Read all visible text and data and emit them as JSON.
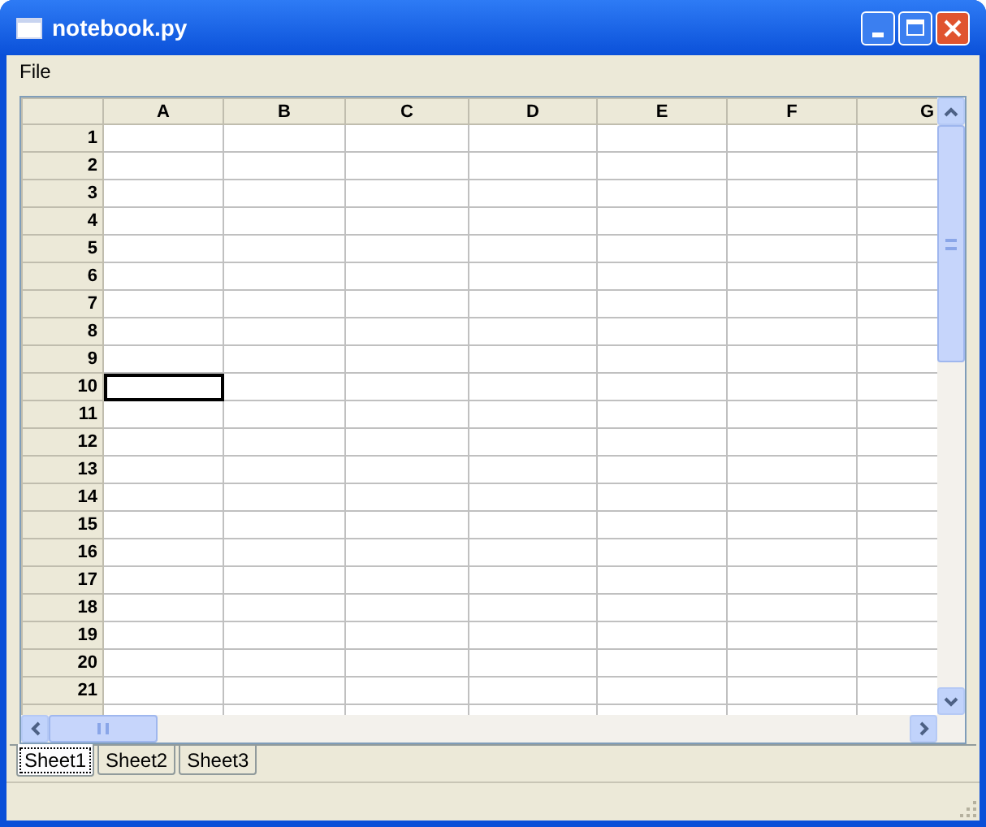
{
  "window": {
    "title": "notebook.py"
  },
  "menu": [
    "File"
  ],
  "grid": {
    "columns": [
      "A",
      "B",
      "C",
      "D",
      "E",
      "F",
      "G"
    ],
    "rows": [
      {
        "label": "1",
        "cells": [
          {
            "selected": false
          },
          {
            "selected": false
          },
          {
            "selected": false
          },
          {
            "selected": false
          },
          {
            "selected": false
          },
          {
            "selected": false
          },
          {
            "selected": false
          }
        ]
      },
      {
        "label": "2",
        "cells": [
          {
            "selected": false
          },
          {
            "selected": false
          },
          {
            "selected": false
          },
          {
            "selected": false
          },
          {
            "selected": false
          },
          {
            "selected": false
          },
          {
            "selected": false
          }
        ]
      },
      {
        "label": "3",
        "cells": [
          {
            "selected": false
          },
          {
            "selected": false
          },
          {
            "selected": false
          },
          {
            "selected": false
          },
          {
            "selected": false
          },
          {
            "selected": false
          },
          {
            "selected": false
          }
        ]
      },
      {
        "label": "4",
        "cells": [
          {
            "selected": false
          },
          {
            "selected": false
          },
          {
            "selected": false
          },
          {
            "selected": false
          },
          {
            "selected": false
          },
          {
            "selected": false
          },
          {
            "selected": false
          }
        ]
      },
      {
        "label": "5",
        "cells": [
          {
            "selected": false
          },
          {
            "selected": false
          },
          {
            "selected": false
          },
          {
            "selected": false
          },
          {
            "selected": false
          },
          {
            "selected": false
          },
          {
            "selected": false
          }
        ]
      },
      {
        "label": "6",
        "cells": [
          {
            "selected": false
          },
          {
            "selected": false
          },
          {
            "selected": false
          },
          {
            "selected": false
          },
          {
            "selected": false
          },
          {
            "selected": false
          },
          {
            "selected": false
          }
        ]
      },
      {
        "label": "7",
        "cells": [
          {
            "selected": false
          },
          {
            "selected": false
          },
          {
            "selected": false
          },
          {
            "selected": false
          },
          {
            "selected": false
          },
          {
            "selected": false
          },
          {
            "selected": false
          }
        ]
      },
      {
        "label": "8",
        "cells": [
          {
            "selected": false
          },
          {
            "selected": false
          },
          {
            "selected": false
          },
          {
            "selected": false
          },
          {
            "selected": false
          },
          {
            "selected": false
          },
          {
            "selected": false
          }
        ]
      },
      {
        "label": "9",
        "cells": [
          {
            "selected": false
          },
          {
            "selected": false
          },
          {
            "selected": false
          },
          {
            "selected": false
          },
          {
            "selected": false
          },
          {
            "selected": false
          },
          {
            "selected": false
          }
        ]
      },
      {
        "label": "10",
        "cells": [
          {
            "selected": true
          },
          {
            "selected": false
          },
          {
            "selected": false
          },
          {
            "selected": false
          },
          {
            "selected": false
          },
          {
            "selected": false
          },
          {
            "selected": false
          }
        ]
      },
      {
        "label": "11",
        "cells": [
          {
            "selected": false
          },
          {
            "selected": false
          },
          {
            "selected": false
          },
          {
            "selected": false
          },
          {
            "selected": false
          },
          {
            "selected": false
          },
          {
            "selected": false
          }
        ]
      },
      {
        "label": "12",
        "cells": [
          {
            "selected": false
          },
          {
            "selected": false
          },
          {
            "selected": false
          },
          {
            "selected": false
          },
          {
            "selected": false
          },
          {
            "selected": false
          },
          {
            "selected": false
          }
        ]
      },
      {
        "label": "13",
        "cells": [
          {
            "selected": false
          },
          {
            "selected": false
          },
          {
            "selected": false
          },
          {
            "selected": false
          },
          {
            "selected": false
          },
          {
            "selected": false
          },
          {
            "selected": false
          }
        ]
      },
      {
        "label": "14",
        "cells": [
          {
            "selected": false
          },
          {
            "selected": false
          },
          {
            "selected": false
          },
          {
            "selected": false
          },
          {
            "selected": false
          },
          {
            "selected": false
          },
          {
            "selected": false
          }
        ]
      },
      {
        "label": "15",
        "cells": [
          {
            "selected": false
          },
          {
            "selected": false
          },
          {
            "selected": false
          },
          {
            "selected": false
          },
          {
            "selected": false
          },
          {
            "selected": false
          },
          {
            "selected": false
          }
        ]
      },
      {
        "label": "16",
        "cells": [
          {
            "selected": false
          },
          {
            "selected": false
          },
          {
            "selected": false
          },
          {
            "selected": false
          },
          {
            "selected": false
          },
          {
            "selected": false
          },
          {
            "selected": false
          }
        ]
      },
      {
        "label": "17",
        "cells": [
          {
            "selected": false
          },
          {
            "selected": false
          },
          {
            "selected": false
          },
          {
            "selected": false
          },
          {
            "selected": false
          },
          {
            "selected": false
          },
          {
            "selected": false
          }
        ]
      },
      {
        "label": "18",
        "cells": [
          {
            "selected": false
          },
          {
            "selected": false
          },
          {
            "selected": false
          },
          {
            "selected": false
          },
          {
            "selected": false
          },
          {
            "selected": false
          },
          {
            "selected": false
          }
        ]
      },
      {
        "label": "19",
        "cells": [
          {
            "selected": false
          },
          {
            "selected": false
          },
          {
            "selected": false
          },
          {
            "selected": false
          },
          {
            "selected": false
          },
          {
            "selected": false
          },
          {
            "selected": false
          }
        ]
      },
      {
        "label": "20",
        "cells": [
          {
            "selected": false
          },
          {
            "selected": false
          },
          {
            "selected": false
          },
          {
            "selected": false
          },
          {
            "selected": false
          },
          {
            "selected": false
          },
          {
            "selected": false
          }
        ]
      },
      {
        "label": "21",
        "cells": [
          {
            "selected": false
          },
          {
            "selected": false
          },
          {
            "selected": false
          },
          {
            "selected": false
          },
          {
            "selected": false
          },
          {
            "selected": false
          },
          {
            "selected": false
          }
        ]
      }
    ]
  },
  "sheet_tabs": [
    {
      "label": "Sheet1",
      "selected": true
    },
    {
      "label": "Sheet2",
      "selected": false
    },
    {
      "label": "Sheet3",
      "selected": false
    }
  ]
}
